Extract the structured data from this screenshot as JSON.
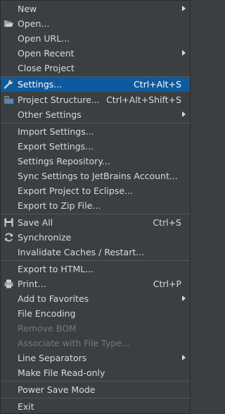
{
  "colors": {
    "background": "#3c3f41",
    "selected": "#0d5a9e",
    "separator": "#515658",
    "text": "#dadada",
    "disabled": "#777777"
  },
  "menu": {
    "new": {
      "label": "New"
    },
    "open": {
      "label": "Open...",
      "icon": "folder-open-icon"
    },
    "open_url": {
      "label": "Open URL..."
    },
    "open_recent": {
      "label": "Open Recent"
    },
    "close_project": {
      "label": "Close Project"
    },
    "settings": {
      "label": "Settings...",
      "shortcut": "Ctrl+Alt+S",
      "icon": "wrench-icon"
    },
    "project_structure": {
      "label": "Project Structure...",
      "shortcut": "Ctrl+Alt+Shift+S",
      "icon": "project-structure-icon"
    },
    "other_settings": {
      "label": "Other Settings"
    },
    "import_settings": {
      "label": "Import Settings..."
    },
    "export_settings": {
      "label": "Export Settings..."
    },
    "settings_repository": {
      "label": "Settings Repository..."
    },
    "sync_settings": {
      "label": "Sync Settings to JetBrains Account..."
    },
    "export_eclipse": {
      "label": "Export Project to Eclipse..."
    },
    "export_zip": {
      "label": "Export to Zip File..."
    },
    "save_all": {
      "label": "Save All",
      "shortcut": "Ctrl+S",
      "icon": "save-icon"
    },
    "synchronize": {
      "label": "Synchronize",
      "icon": "sync-icon"
    },
    "invalidate_caches": {
      "label": "Invalidate Caches / Restart..."
    },
    "export_html": {
      "label": "Export to HTML..."
    },
    "print": {
      "label": "Print...",
      "shortcut": "Ctrl+P",
      "icon": "printer-icon"
    },
    "add_favorites": {
      "label": "Add to Favorites"
    },
    "file_encoding": {
      "label": "File Encoding"
    },
    "remove_bom": {
      "label": "Remove BOM"
    },
    "associate_file_type": {
      "label": "Associate with File Type..."
    },
    "line_separators": {
      "label": "Line Separators"
    },
    "make_read_only": {
      "label": "Make File Read-only"
    },
    "power_save_mode": {
      "label": "Power Save Mode"
    },
    "exit": {
      "label": "Exit"
    }
  }
}
